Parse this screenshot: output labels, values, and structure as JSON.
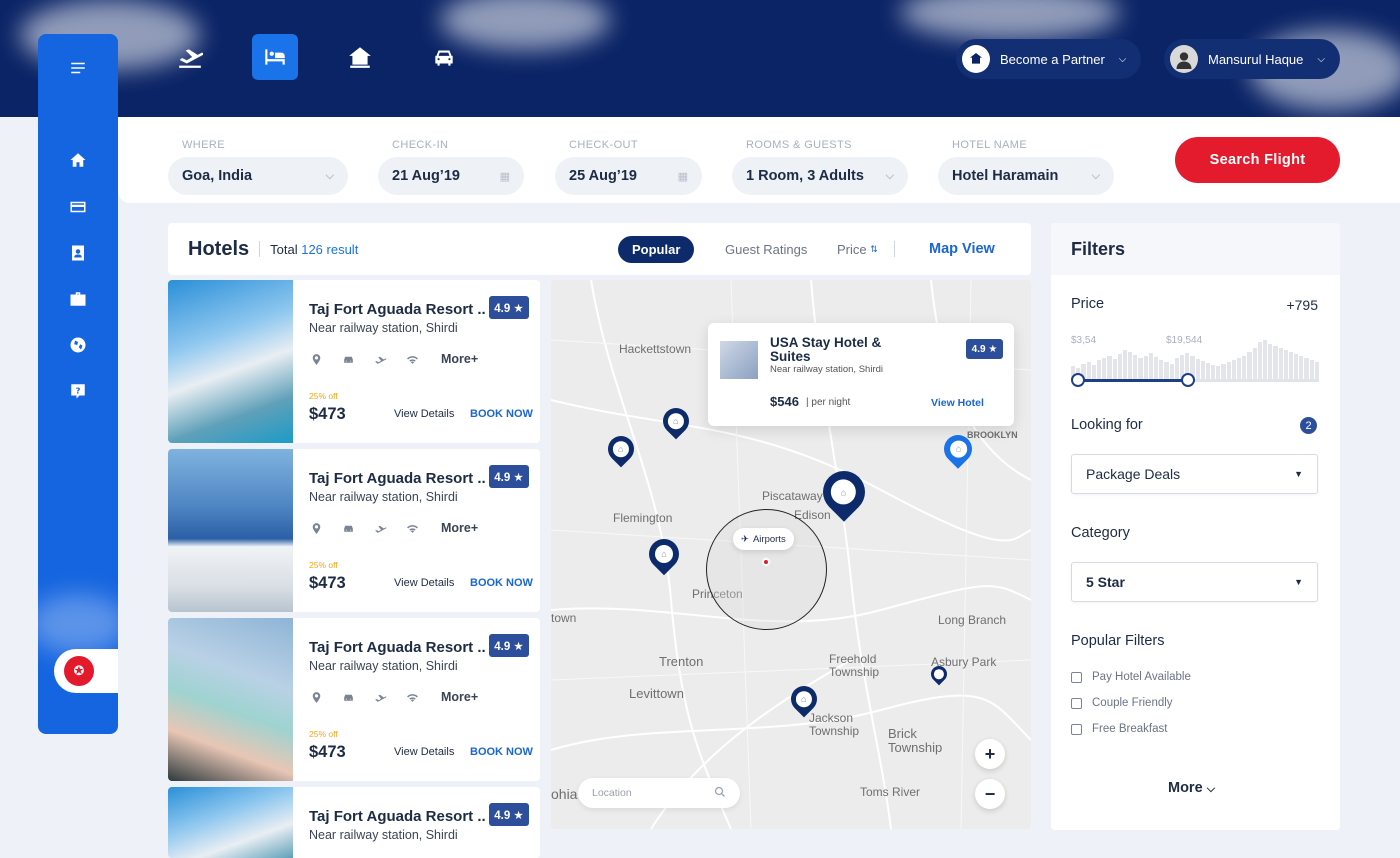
{
  "header": {
    "nav": [
      "flights-icon",
      "hotels-icon",
      "homes-icon",
      "cars-icon"
    ],
    "partner_label": "Become a Partner",
    "user_name": "Mansurul Haque"
  },
  "search": {
    "where_label": "WHERE",
    "where_value": "Goa, India",
    "checkin_label": "CHECK-IN",
    "checkin_value": "21 Aug’19",
    "checkout_label": "CHECK-OUT",
    "checkout_value": "25 Aug’19",
    "rooms_label": "ROOMS & GUESTS",
    "rooms_value": "1 Room, 3 Adults",
    "hotel_label": "HOTEL NAME",
    "hotel_value": "Hotel Haramain",
    "button": "Search  Flight"
  },
  "hotels": {
    "title": "Hotels",
    "total_label": "Total",
    "total_value": "126 result",
    "sort_popular": "Popular",
    "sort_ratings": "Guest Ratings",
    "sort_price": "Price",
    "map_view": "Map View",
    "list": [
      {
        "name": "Taj Fort Aguada Resort ..",
        "location": "Near railway station, Shirdi",
        "rating": "4.9 ★",
        "more": "More+",
        "discount": "25% off",
        "price": "$473",
        "view": "View Details",
        "book": "BOOK NOW"
      },
      {
        "name": "Taj Fort Aguada Resort ..",
        "location": "Near railway station, Shirdi",
        "rating": "4.9 ★",
        "more": "More+",
        "discount": "25% off",
        "price": "$473",
        "view": "View Details",
        "book": "BOOK NOW"
      },
      {
        "name": "Taj Fort Aguada Resort ..",
        "location": "Near railway station, Shirdi",
        "rating": "4.9 ★",
        "more": "More+",
        "discount": "25% off",
        "price": "$473",
        "view": "View Details",
        "book": "BOOK NOW"
      },
      {
        "name": "Taj Fort Aguada Resort ..",
        "location": "Near railway station, Shirdi",
        "rating": "4.9 ★"
      }
    ]
  },
  "map": {
    "labels": [
      "Hackettstown",
      "Flemington",
      "Piscataway",
      "Edison",
      "Princeton",
      "Trenton",
      "Levittown",
      "Freehold Township",
      "Asbury Park",
      "Long Branch",
      "Jackson Township",
      "Brick Township",
      "Toms River",
      "BROOKLYN",
      "town",
      "ohia"
    ],
    "popup": {
      "name": "USA Stay Hotel & Suites",
      "location": "Near railway station, Shirdi",
      "rating": "4.9 ★",
      "price": "$546",
      "per": "per night",
      "view": "View Hotel"
    },
    "airport_label": "Airports",
    "location_placeholder": "Location",
    "zoom_in": "+",
    "zoom_out": "−"
  },
  "filters": {
    "title": "Filters",
    "price_label": "Price",
    "price_value": "+795",
    "price_min": "$3,54",
    "price_max": "$19,544",
    "price_range_fraction": [
      0.0,
      0.46
    ],
    "looking_label": "Looking for",
    "looking_count": "2",
    "looking_value": "Package Deals",
    "category_label": "Category",
    "category_value": "5 Star",
    "popular_label": "Popular Filters",
    "options": [
      "Pay Hotel Available",
      "Couple Friendly",
      "Free Breakfast"
    ],
    "more": "More"
  },
  "colors": {
    "navy": "#0b2466",
    "primary": "#1565e0",
    "red": "#e31b2d",
    "rating": "#2d4f9b"
  }
}
